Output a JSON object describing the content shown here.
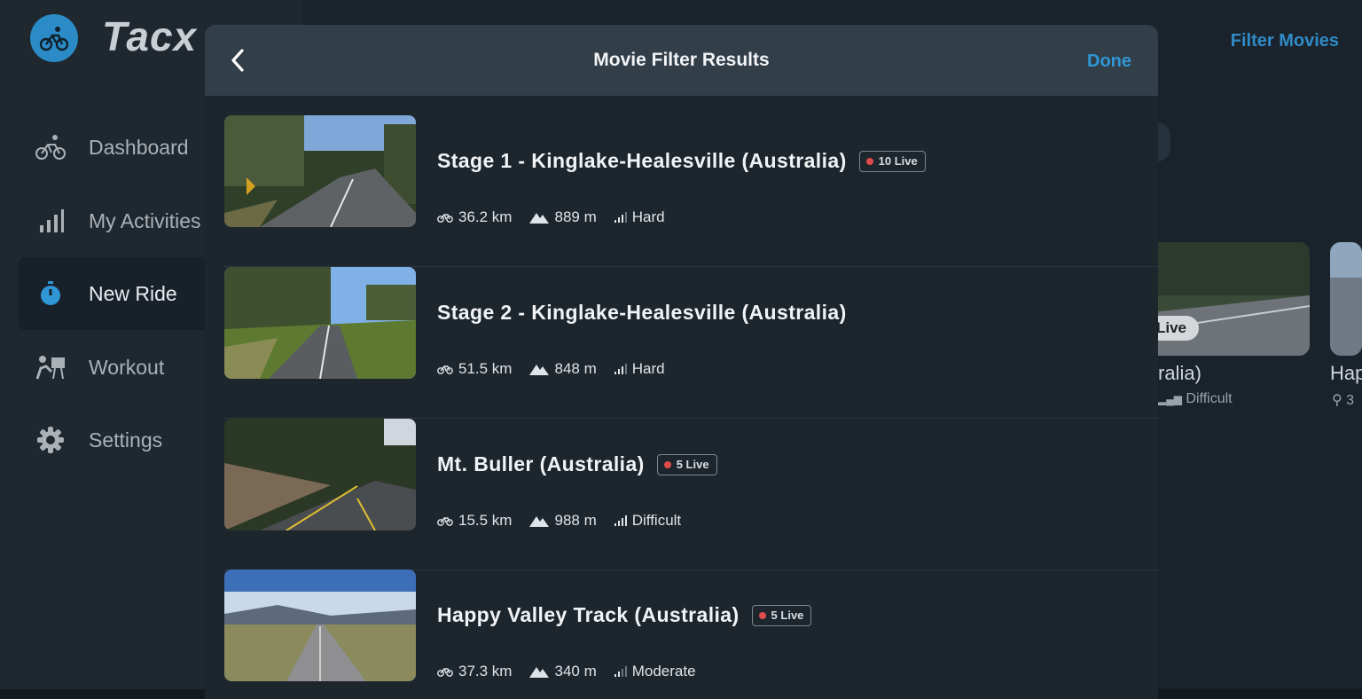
{
  "app": {
    "logo_text": "Tacx",
    "accent": "#2f97d6",
    "filter_link": "Filter Movies"
  },
  "sidebar": {
    "items": [
      {
        "label": "Dashboard",
        "icon": "bike-rider-icon"
      },
      {
        "label": "My Activities",
        "icon": "bar-chart-icon"
      },
      {
        "label": "New Ride",
        "icon": "stopwatch-icon",
        "active": true
      },
      {
        "label": "Workout",
        "icon": "workout-icon"
      },
      {
        "label": "Settings",
        "icon": "gear-icon"
      }
    ]
  },
  "background_cards": [
    {
      "title": "ralia)",
      "live": "Live",
      "difficulty": "Difficult"
    },
    {
      "title": "Hap",
      "distance_fragment": "3"
    }
  ],
  "modal": {
    "title": "Movie Filter Results",
    "done_label": "Done",
    "results": [
      {
        "title": "Stage 1 - Kinglake-Healesville (Australia)",
        "live": "10 Live",
        "distance": "36.2 km",
        "elevation": "889 m",
        "difficulty": "Hard"
      },
      {
        "title": "Stage 2 - Kinglake-Healesville (Australia)",
        "live": "",
        "distance": "51.5 km",
        "elevation": "848 m",
        "difficulty": "Hard"
      },
      {
        "title": "Mt. Buller (Australia)",
        "live": "5 Live",
        "distance": "15.5 km",
        "elevation": "988 m",
        "difficulty": "Difficult"
      },
      {
        "title": "Happy Valley Track (Australia)",
        "live": "5 Live",
        "distance": "37.3 km",
        "elevation": "340 m",
        "difficulty": "Moderate"
      }
    ]
  }
}
